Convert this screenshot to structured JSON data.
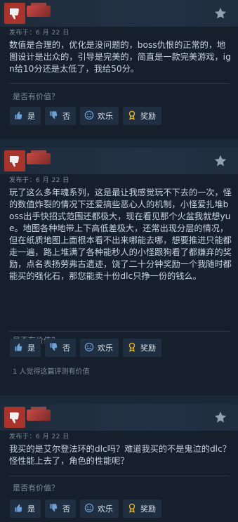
{
  "reviews": [
    {
      "posted": "发布于：6 月 22 日",
      "text": "数值是合理的，优化是没问题的，boss仇恨的正常的，地图设计是出众的，引导是完美的，简直是一款完美游戏，ign给10分还是太低了，我给50分。",
      "helpful_question": "是否有价值？",
      "yes": "是",
      "no": "否",
      "funny": "欢乐",
      "award": "奖励",
      "footnote": ""
    },
    {
      "posted": "发布于：6 月 22 日",
      "text": "玩了这么多年魂系列，这是最让我感觉玩不下去的一次，怪的数值炸裂的情况下还爱搞些恶心人的机制，小怪爱扎堆boss出手快招式范围还都极大，现在看见那个火盆我就想yue。地图各种地带上下高低差极大，还常出现分层的情况，但在纸质地图上面根本看不出来哪能去哪，想要推进只能都走一遍，路上堆满了各种能秒人的小怪跟狗看了都嫌弃的奖励，点名表扬劳弗古遗迹，饶了二十分钟奖励一个我随时都能买的强化石，那您能卖十份dlc只挣一份的钱么。",
      "helpful_question": "是否有价值？",
      "yes": "是",
      "no": "否",
      "funny": "欢乐",
      "award": "奖励",
      "footnote": "1 人觉得这篇评测有价值"
    },
    {
      "posted": "发布于：6 月 22 日",
      "text": "我买的是艾尔登法环的dlc吗？难道我买的不是鬼泣的dlc？怪性能上去了，角色的性能呢？",
      "helpful_question": "是否有价值？",
      "yes": "是",
      "no": "否",
      "funny": "欢乐",
      "award": "奖励",
      "footnote": ""
    }
  ],
  "colors": {
    "background": "#1b2838",
    "card": "#16202d",
    "thumb_down": "#a8342c",
    "award_icon": "#e6b422"
  },
  "icons": {
    "header_left": "thumbs-down-icon",
    "header_right": "star-icon",
    "yes": "thumbs-up-icon",
    "no": "thumbs-down-icon",
    "funny": "smiley-icon",
    "award": "award-icon"
  }
}
